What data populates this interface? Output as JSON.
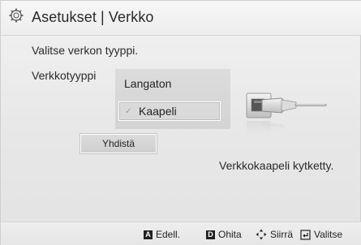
{
  "header": {
    "title": "Asetukset | Verkko",
    "icon": "gear-icon"
  },
  "main": {
    "prompt": "Valitse verkon tyyppi.",
    "network_type_label": "Verkkotyyppi",
    "options": [
      {
        "label": "Langaton",
        "selected": false
      },
      {
        "label": "Kaapeli",
        "selected": true
      }
    ],
    "check_glyph": "✓",
    "connect_button": "Yhdistä",
    "status": "Verkkokaapeli kytketty.",
    "illustration_icon": "ethernet-cable-icon"
  },
  "footer": {
    "hints": [
      {
        "key": "A",
        "label": "Edell.",
        "icon": "a-key-icon"
      },
      {
        "key": "D",
        "label": "Ohita",
        "icon": "d-key-icon"
      },
      {
        "label": "Siirrä",
        "icon": "move-arrows-icon"
      },
      {
        "label": "Valitse",
        "icon": "enter-icon"
      }
    ]
  }
}
